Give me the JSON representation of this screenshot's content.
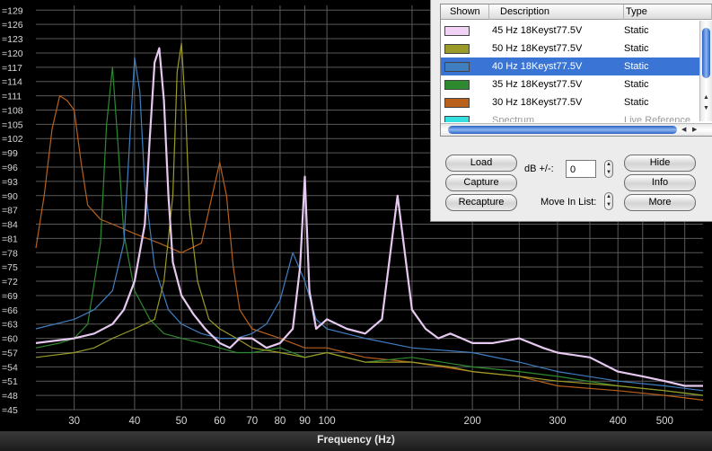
{
  "chart_data": {
    "type": "line",
    "xlabel": "Frequency (Hz)",
    "x_scale": "log",
    "xlim": [
      25,
      600
    ],
    "ylim": [
      45,
      130
    ],
    "y_ticks": [
      45,
      48,
      51,
      54,
      57,
      60,
      63,
      66,
      69,
      72,
      75,
      78,
      81,
      84,
      87,
      90,
      93,
      96,
      99,
      102,
      105,
      108,
      111,
      114,
      117,
      120,
      123,
      126,
      129
    ],
    "y_tick_labels": [
      "=45",
      "=48",
      "=51",
      "=54",
      "=57",
      "=60",
      "=63",
      "=66",
      "=69",
      "=72",
      "=75",
      "=78",
      "=81",
      "=84",
      "=87",
      "=90",
      "=93",
      "=96",
      "=99",
      "=102",
      "=105",
      "=108",
      "=111",
      "=114",
      "=117",
      "=120",
      "=123",
      "=126",
      "=129"
    ],
    "x_ticks": [
      30,
      40,
      50,
      60,
      70,
      80,
      90,
      100,
      200,
      300,
      400,
      500
    ],
    "x_tick_labels": [
      "30",
      "40",
      "50",
      "60",
      "70",
      "80",
      "90",
      "100",
      "200",
      "300",
      "400",
      "500"
    ],
    "grid": true,
    "series": [
      {
        "name": "45 Hz 18Keyst77.5V",
        "color": "#e6c8f0",
        "x": [
          25,
          30,
          33,
          36,
          38,
          40,
          42,
          43,
          44,
          45,
          46,
          47,
          48,
          50,
          53,
          56,
          60,
          63,
          66,
          70,
          75,
          80,
          85,
          88,
          90,
          92,
          95,
          100,
          110,
          120,
          130,
          140,
          150,
          160,
          170,
          180,
          190,
          200,
          220,
          250,
          280,
          300,
          350,
          400,
          450,
          500,
          550,
          600
        ],
        "y": [
          59,
          60,
          61,
          63,
          66,
          72,
          84,
          102,
          118,
          121,
          110,
          90,
          76,
          69,
          65,
          62,
          59,
          58,
          60,
          60,
          58,
          59,
          62,
          75,
          94,
          70,
          62,
          64,
          62,
          61,
          64,
          90,
          66,
          62,
          60,
          61,
          60,
          59,
          59,
          60,
          58,
          57,
          56,
          53,
          52,
          51,
          50,
          50
        ]
      },
      {
        "name": "50 Hz 18Keyst77.5V",
        "color": "#9a9a28",
        "x": [
          25,
          30,
          33,
          36,
          40,
          44,
          46,
          48,
          49,
          50,
          51,
          52,
          54,
          57,
          60,
          65,
          70,
          80,
          90,
          100,
          120,
          150,
          180,
          200,
          250,
          300,
          400,
          500,
          600
        ],
        "y": [
          56,
          57,
          58,
          60,
          62,
          64,
          72,
          90,
          116,
          122,
          108,
          86,
          72,
          64,
          62,
          60,
          58,
          57,
          56,
          57,
          55,
          55,
          54,
          53,
          52,
          51,
          50,
          49,
          48
        ]
      },
      {
        "name": "40 Hz 18Keyst77.5V",
        "color": "#3f7fc0",
        "x": [
          25,
          30,
          33,
          36,
          38,
          39,
          40,
          41,
          42,
          44,
          47,
          50,
          55,
          60,
          65,
          70,
          75,
          80,
          85,
          90,
          95,
          100,
          120,
          150,
          200,
          250,
          300,
          400,
          500,
          600
        ],
        "y": [
          62,
          64,
          66,
          70,
          80,
          100,
          119,
          112,
          92,
          75,
          66,
          63,
          61,
          60,
          60,
          61,
          63,
          68,
          78,
          72,
          64,
          62,
          60,
          58,
          57,
          55,
          53,
          51,
          50,
          49
        ]
      },
      {
        "name": "35 Hz 18Keyst77.5V",
        "color": "#2e8a2e",
        "x": [
          25,
          28,
          30,
          32,
          34,
          35,
          36,
          37,
          38,
          40,
          43,
          46,
          50,
          55,
          60,
          65,
          70,
          80,
          90,
          100,
          120,
          150,
          200,
          250,
          300,
          400,
          500,
          600
        ],
        "y": [
          58,
          59,
          60,
          63,
          80,
          105,
          117,
          100,
          82,
          70,
          64,
          61,
          60,
          59,
          58,
          57,
          57,
          58,
          56,
          57,
          55,
          56,
          54,
          53,
          52,
          50,
          49,
          48
        ]
      },
      {
        "name": "30 Hz 18Keyst77.5V",
        "color": "#b8601c",
        "x": [
          25,
          26,
          27,
          28,
          29,
          30,
          31,
          32,
          34,
          36,
          40,
          45,
          50,
          55,
          60,
          62,
          64,
          66,
          70,
          80,
          90,
          100,
          120,
          150,
          200,
          250,
          300,
          400,
          500,
          600
        ],
        "y": [
          79,
          90,
          104,
          111,
          110,
          108,
          97,
          88,
          85,
          84,
          82,
          80,
          78,
          80,
          97,
          90,
          75,
          66,
          62,
          60,
          58,
          58,
          56,
          55,
          53,
          52,
          50,
          49,
          48,
          47
        ]
      }
    ]
  },
  "panel": {
    "columns": {
      "shown": "Shown",
      "description": "Description",
      "type": "Type"
    },
    "rows": [
      {
        "description": "45 Hz 18Keyst77.5V",
        "type": "Static",
        "color": "#f2d2f4",
        "selected": false
      },
      {
        "description": "50 Hz 18Keyst77.5V",
        "type": "Static",
        "color": "#9a9a28",
        "selected": false
      },
      {
        "description": "40 Hz 18Keyst77.5V",
        "type": "Static",
        "color": "#3f7fc0",
        "selected": true
      },
      {
        "description": "35 Hz 18Keyst77.5V",
        "type": "Static",
        "color": "#2e8a2e",
        "selected": false
      },
      {
        "description": "30 Hz 18Keyst77.5V",
        "type": "Static",
        "color": "#b8601c",
        "selected": false
      },
      {
        "description": "Spectrum",
        "type": "Live Reference",
        "color": "#35e0e0",
        "selected": false
      }
    ],
    "buttons": {
      "load": "Load",
      "capture": "Capture",
      "recapture": "Recapture",
      "hide": "Hide",
      "info": "Info",
      "more": "More"
    },
    "db_label": "dB +/-:",
    "db_value": "0",
    "move_label": "Move In List:"
  }
}
